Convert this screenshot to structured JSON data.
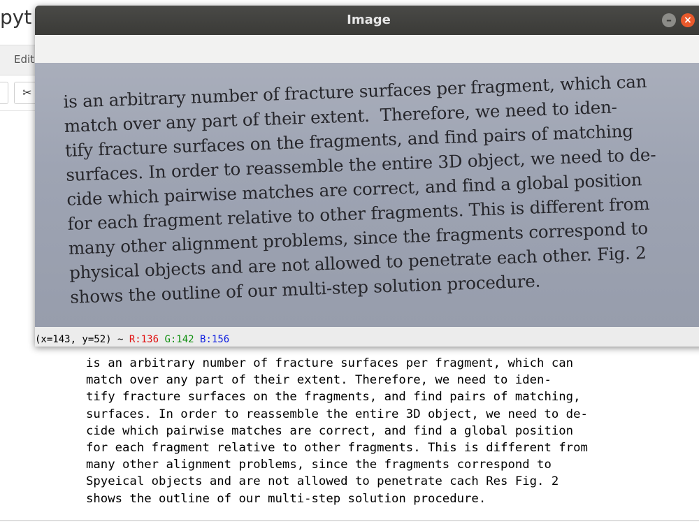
{
  "background_app": {
    "title": "pyt",
    "menu": {
      "edit": "Edit"
    },
    "toolbar": {
      "cut_icon": "scissors-icon",
      "cut_glyph": "✂"
    },
    "output_lines": [
      "is an arbitrary number of fracture surfaces per fragment, which can",
      "match over any part of their extent. Therefore, we need to iden-",
      "tify fracture surfaces on the fragments, and find pairs of matching,",
      "surfaces. In order to reassemble the entire 3D object, we need to de-",
      "cide which pairwise matches are correct, and find a global position",
      "for each fragment relative to other fragments. This is different from",
      "many other alignment problems, since the fragments correspond to",
      "Spyeical objects and are not allowed to penetrate cach Res Fig. 2",
      "shows the outline of our multi-step solution procedure."
    ]
  },
  "image_window": {
    "title": "Image",
    "minimize_glyph": "–",
    "close_glyph": "×",
    "scan_lines": [
      "is an arbitrary number of fracture surfaces per fragment, which can",
      "match over any part of their extent.  Therefore, we need to iden-",
      "tify fracture surfaces on the fragments, and find pairs of matching",
      "surfaces. In order to reassemble the entire 3D object, we need to de-",
      "cide which pairwise matches are correct, and find a global position",
      "for each fragment relative to other fragments. This is different from",
      "many other alignment problems, since the fragments correspond to",
      "physical objects and are not allowed to penetrate each other. Fig. 2",
      "shows the outline of our multi-step solution procedure."
    ],
    "status": {
      "coords": "(x=143, y=52) ~ ",
      "r": "R:136",
      "g": "G:142",
      "b": "B:156"
    }
  },
  "colors": {
    "titlebar": "#3d3d3a",
    "close": "#e9592c",
    "scan_background": "#a1a7b5"
  }
}
